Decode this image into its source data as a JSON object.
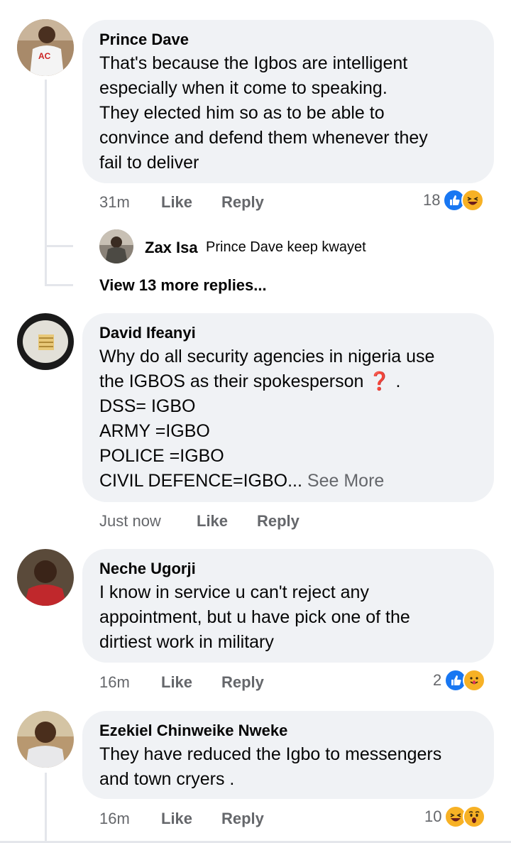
{
  "comments": [
    {
      "author": "Prince Dave",
      "text": "That's because the Igbos are intelligent\nespecially when it come to speaking.\nThey elected him so as to be able to\nconvince and defend them whenever they\nfail to deliver",
      "time": "31m",
      "like": "Like",
      "reply": "Reply",
      "reaction_count": "18",
      "reactions": [
        "like-icon",
        "laugh-icon"
      ],
      "sub_reply": {
        "author": "Zax Isa",
        "text": "Prince Dave keep kwayet"
      },
      "view_more": "View 13 more replies..."
    },
    {
      "author": "David Ifeanyi",
      "text": "Why do all security agencies in nigeria use\nthe IGBOS as their spokesperson",
      "text_after_emoji": " .",
      "lines": [
        "DSS= IGBO",
        "ARMY =IGBO",
        "POLICE =IGBO",
        "CIVIL DEFENCE=IGBO..."
      ],
      "see_more": "See More",
      "time": "Just now",
      "like": "Like",
      "reply": "Reply"
    },
    {
      "author": "Neche Ugorji",
      "text": "I know in service u can't reject any\nappointment, but u have pick one of the\ndirtiest work in military",
      "time": "16m",
      "like": "Like",
      "reply": "Reply",
      "reaction_count": "2",
      "reactions": [
        "like-icon",
        "care-icon"
      ]
    },
    {
      "author": "Ezekiel Chinweike Nweke",
      "text": "They have reduced the Igbo to messengers\nand town cryers .",
      "time": "16m",
      "like": "Like",
      "reply": "Reply",
      "reaction_count": "10",
      "reactions": [
        "laugh-icon",
        "wow-icon"
      ]
    }
  ],
  "colors": {
    "like_blue": "#1877f2",
    "reaction_yellow": "#f7b125",
    "bubble": "#f0f2f5",
    "meta_gray": "#65676b"
  }
}
